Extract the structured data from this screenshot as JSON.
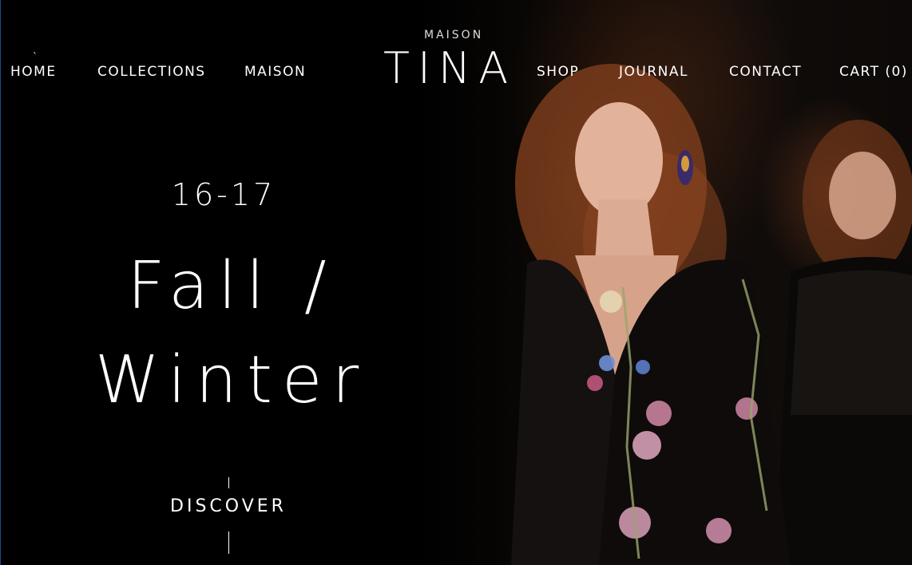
{
  "nav": {
    "left": [
      {
        "label": "HOME"
      },
      {
        "label": "COLLECTIONS"
      },
      {
        "label": "MAISON"
      }
    ],
    "right": [
      {
        "label": "SHOP"
      },
      {
        "label": "JOURNAL"
      },
      {
        "label": "CONTACT"
      },
      {
        "label": "CART (0)"
      }
    ]
  },
  "logo": {
    "subtitle": "MAISON",
    "title": "TINA"
  },
  "hero": {
    "season": "16-17",
    "headline_line1": "Fall /",
    "headline_line2": "Winter",
    "cta": "DISCOVER"
  },
  "colors": {
    "background": "#000000",
    "text": "#ffffff"
  }
}
